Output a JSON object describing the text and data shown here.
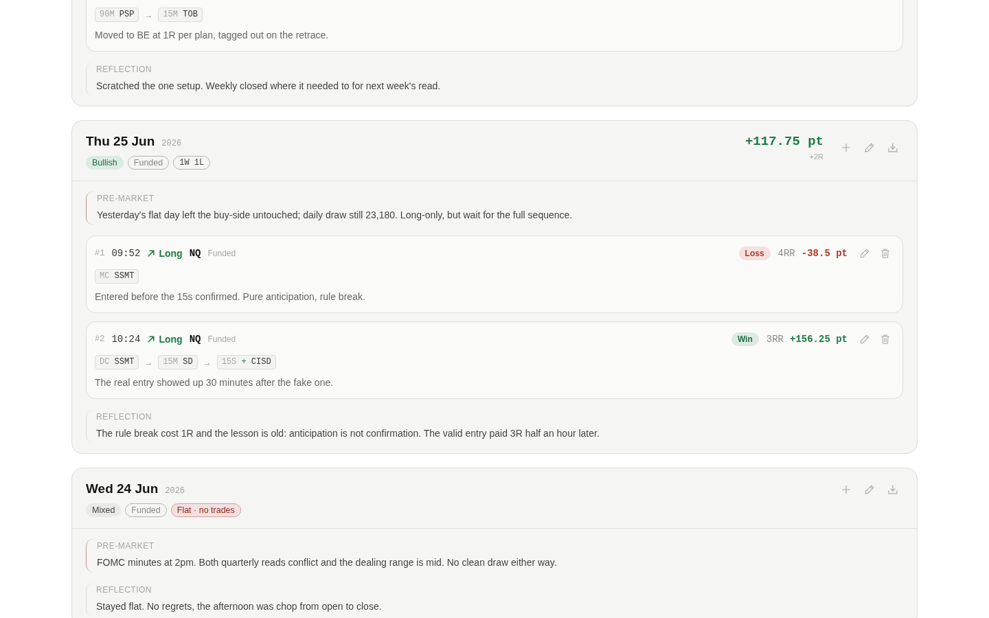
{
  "days": [
    {
      "trades": [
        {
          "chain": [
            {
              "kind": "chip",
              "prefix": "90M",
              "label": "PSP"
            },
            {
              "kind": "arrow",
              "text": "→"
            },
            {
              "kind": "chip",
              "prefix": "15M",
              "label": "TOB"
            }
          ],
          "note": "Moved to BE at 1R per plan, tagged out on the retrace."
        }
      ],
      "reflection": {
        "label": "REFLECTION",
        "text": "Scratched the one setup. Weekly closed where it needed to for next week's read."
      }
    },
    {
      "title": "Thu 25 Jun",
      "year": "2026",
      "tags": [
        {
          "kind": "positive",
          "text": "Bullish"
        },
        {
          "kind": "account",
          "text": "Funded"
        },
        {
          "kind": "record",
          "text": "1W 1L"
        }
      ],
      "pnl": {
        "kind": "gain",
        "value": "+117.75 pt",
        "r": "+2R"
      },
      "premarket": {
        "label": "PRE-MARKET",
        "text": "Yesterday's flat day left the buy-side untouched; daily draw still 23,180. Long-only, but wait for the full sequence."
      },
      "trades": [
        {
          "number": "#1",
          "time": "09:52",
          "direction": {
            "kind": "long",
            "text": "Long"
          },
          "symbol": "NQ",
          "account": "Funded",
          "outcome": {
            "kind": "loss",
            "text": "Loss"
          },
          "rr": "4RR",
          "pnl": "-38.5 pt",
          "chain": [
            {
              "kind": "chip",
              "prefix": "MC",
              "label": "SSMT"
            }
          ],
          "note": "Entered before the 15s confirmed. Pure anticipation, rule break."
        },
        {
          "number": "#2",
          "time": "10:24",
          "direction": {
            "kind": "long",
            "text": "Long"
          },
          "symbol": "NQ",
          "account": "Funded",
          "outcome": {
            "kind": "win",
            "text": "Win"
          },
          "rr": "3RR",
          "pnl": "+156.25 pt",
          "chain": [
            {
              "kind": "chip",
              "prefix": "DC",
              "label": "SSMT"
            },
            {
              "kind": "arrow",
              "text": "→"
            },
            {
              "kind": "chip",
              "prefix": "15M",
              "label": "SD"
            },
            {
              "kind": "arrow",
              "text": "→"
            },
            {
              "kind": "chip",
              "prefix": "15S",
              "joiner": "+",
              "label": "CISD"
            }
          ],
          "note": "The real entry showed up 30 minutes after the fake one."
        }
      ],
      "reflection": {
        "label": "REFLECTION",
        "text": "The rule break cost 1R and the lesson is old: anticipation is not confirmation. The valid entry paid 3R half an hour later."
      }
    },
    {
      "title": "Wed 24 Jun",
      "year": "2026",
      "tags": [
        {
          "kind": "neutral",
          "text": "Mixed"
        },
        {
          "kind": "account",
          "text": "Funded"
        },
        {
          "kind": "alert",
          "text": "Flat · no trades"
        }
      ],
      "premarket": {
        "label": "PRE-MARKET",
        "text": "FOMC minutes at 2pm. Both quarterly reads conflict and the dealing range is mid. No clean draw either way."
      },
      "reflection": {
        "label": "REFLECTION",
        "text": "Stayed flat. No regrets, the afternoon was chop from open to close."
      }
    }
  ]
}
